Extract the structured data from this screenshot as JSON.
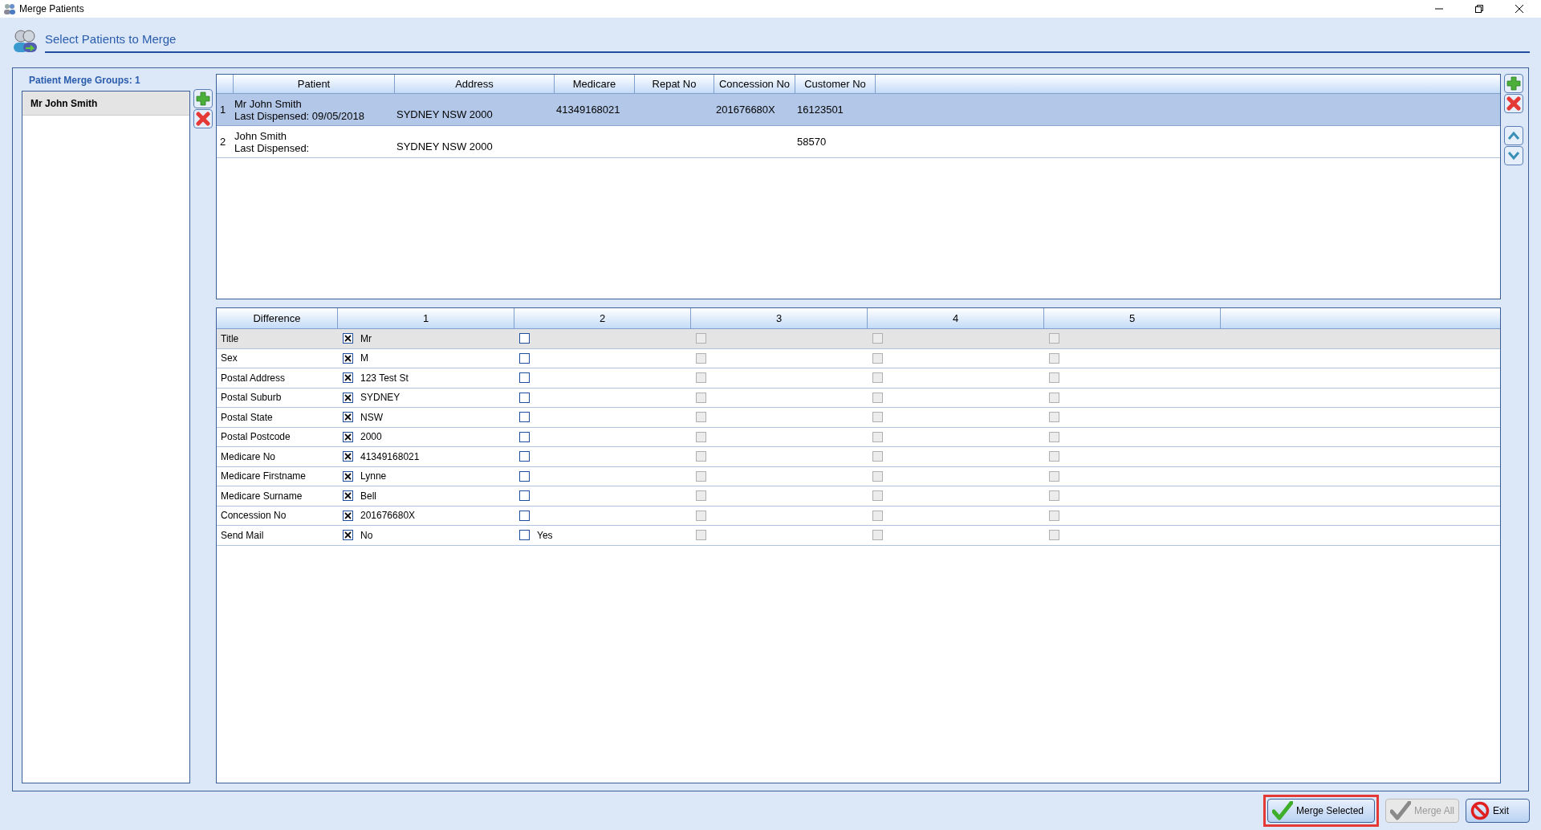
{
  "window": {
    "title": "Merge Patients"
  },
  "header": {
    "title": "Select Patients to Merge"
  },
  "groups": {
    "label": "Patient Merge Groups: 1",
    "items": [
      {
        "name": "Mr John Smith",
        "selected": true
      }
    ]
  },
  "patients": {
    "columns": [
      "Patient",
      "Address",
      "Medicare",
      "Repat No",
      "Concession No",
      "Customer No"
    ],
    "rows": [
      {
        "number": "1",
        "selected": true,
        "name": "Mr John Smith",
        "last_dispensed": "Last Dispensed: 09/05/2018",
        "address": "SYDNEY NSW 2000",
        "medicare": "41349168021",
        "repat": "",
        "concession": "201676680X",
        "customer": "16123501"
      },
      {
        "number": "2",
        "selected": false,
        "name": "John Smith",
        "last_dispensed": "Last Dispensed:",
        "address": "SYDNEY NSW 2000",
        "medicare": "",
        "repat": "",
        "concession": "",
        "customer": "58570"
      }
    ]
  },
  "differences": {
    "columns": [
      "Difference",
      "1",
      "2",
      "3",
      "4",
      "5"
    ],
    "rows": [
      {
        "label": "Title",
        "selected": true,
        "cells": [
          {
            "checked": true,
            "disabled": false,
            "value": "Mr"
          },
          {
            "checked": false,
            "disabled": false
          },
          {
            "checked": false,
            "disabled": true
          },
          {
            "checked": false,
            "disabled": true
          },
          {
            "checked": false,
            "disabled": true
          }
        ]
      },
      {
        "label": "Sex",
        "selected": false,
        "cells": [
          {
            "checked": true,
            "disabled": false,
            "value": "M"
          },
          {
            "checked": false,
            "disabled": false
          },
          {
            "checked": false,
            "disabled": true
          },
          {
            "checked": false,
            "disabled": true
          },
          {
            "checked": false,
            "disabled": true
          }
        ]
      },
      {
        "label": "Postal Address",
        "selected": false,
        "cells": [
          {
            "checked": true,
            "disabled": false,
            "value": "123 Test St"
          },
          {
            "checked": false,
            "disabled": false
          },
          {
            "checked": false,
            "disabled": true
          },
          {
            "checked": false,
            "disabled": true
          },
          {
            "checked": false,
            "disabled": true
          }
        ]
      },
      {
        "label": "Postal Suburb",
        "selected": false,
        "cells": [
          {
            "checked": true,
            "disabled": false,
            "value": "SYDNEY"
          },
          {
            "checked": false,
            "disabled": false
          },
          {
            "checked": false,
            "disabled": true
          },
          {
            "checked": false,
            "disabled": true
          },
          {
            "checked": false,
            "disabled": true
          }
        ]
      },
      {
        "label": "Postal State",
        "selected": false,
        "cells": [
          {
            "checked": true,
            "disabled": false,
            "value": "NSW"
          },
          {
            "checked": false,
            "disabled": false
          },
          {
            "checked": false,
            "disabled": true
          },
          {
            "checked": false,
            "disabled": true
          },
          {
            "checked": false,
            "disabled": true
          }
        ]
      },
      {
        "label": "Postal Postcode",
        "selected": false,
        "cells": [
          {
            "checked": true,
            "disabled": false,
            "value": "2000"
          },
          {
            "checked": false,
            "disabled": false
          },
          {
            "checked": false,
            "disabled": true
          },
          {
            "checked": false,
            "disabled": true
          },
          {
            "checked": false,
            "disabled": true
          }
        ]
      },
      {
        "label": "Medicare No",
        "selected": false,
        "cells": [
          {
            "checked": true,
            "disabled": false,
            "value": "41349168021"
          },
          {
            "checked": false,
            "disabled": false
          },
          {
            "checked": false,
            "disabled": true
          },
          {
            "checked": false,
            "disabled": true
          },
          {
            "checked": false,
            "disabled": true
          }
        ]
      },
      {
        "label": "Medicare Firstname",
        "selected": false,
        "cells": [
          {
            "checked": true,
            "disabled": false,
            "value": "Lynne"
          },
          {
            "checked": false,
            "disabled": false
          },
          {
            "checked": false,
            "disabled": true
          },
          {
            "checked": false,
            "disabled": true
          },
          {
            "checked": false,
            "disabled": true
          }
        ]
      },
      {
        "label": "Medicare Surname",
        "selected": false,
        "cells": [
          {
            "checked": true,
            "disabled": false,
            "value": "Bell"
          },
          {
            "checked": false,
            "disabled": false
          },
          {
            "checked": false,
            "disabled": true
          },
          {
            "checked": false,
            "disabled": true
          },
          {
            "checked": false,
            "disabled": true
          }
        ]
      },
      {
        "label": "Concession No",
        "selected": false,
        "cells": [
          {
            "checked": true,
            "disabled": false,
            "value": "201676680X"
          },
          {
            "checked": false,
            "disabled": false
          },
          {
            "checked": false,
            "disabled": true
          },
          {
            "checked": false,
            "disabled": true
          },
          {
            "checked": false,
            "disabled": true
          }
        ]
      },
      {
        "label": "Send Mail",
        "selected": false,
        "cells": [
          {
            "checked": true,
            "disabled": false,
            "value": "No"
          },
          {
            "checked": false,
            "disabled": false,
            "value": "Yes"
          },
          {
            "checked": false,
            "disabled": true
          },
          {
            "checked": false,
            "disabled": true
          },
          {
            "checked": false,
            "disabled": true
          }
        ]
      }
    ]
  },
  "buttons": [
    {
      "kind": "merge",
      "label": "Merge Selected",
      "disabled": false,
      "highlighted": true
    },
    {
      "kind": "merge",
      "label": "Merge All",
      "disabled": true,
      "highlighted": false
    },
    {
      "kind": "exit",
      "label": "Exit",
      "disabled": false,
      "highlighted": false
    }
  ]
}
